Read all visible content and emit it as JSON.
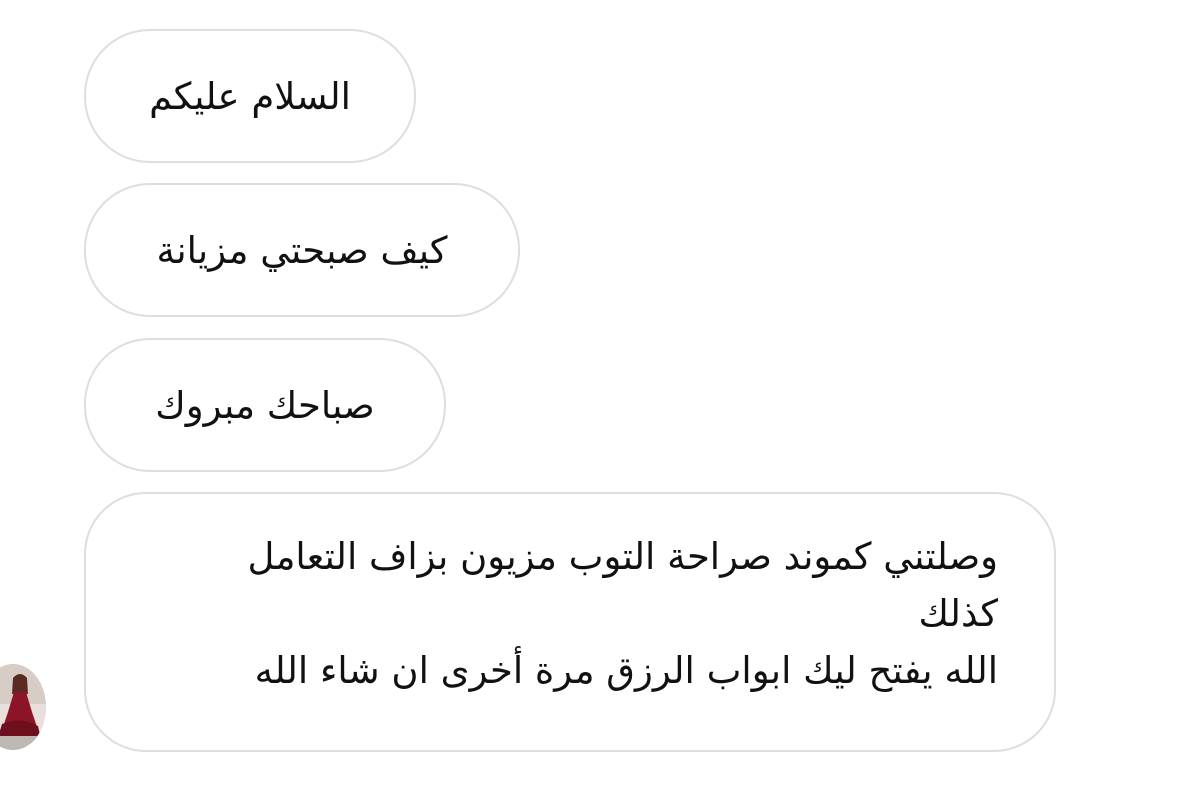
{
  "messages": [
    {
      "text": "السلام عليكم"
    },
    {
      "text": "كيف صبحتي مزيانة"
    },
    {
      "text": "صباحك مبروك"
    },
    {
      "lines": [
        "وصلتني كموند صراحة التوب مزيون بزاف التعامل",
        "كذلك",
        "الله يفتح ليك ابواب الرزق مرة أخرى ان شاء الله"
      ]
    }
  ],
  "avatar": {
    "icon": "sender-avatar-photo",
    "colors": {
      "background": "#e9dfdc",
      "dress": "#8d1326",
      "skin": "#caa48d"
    }
  },
  "colors": {
    "bubble_border": "#dedede",
    "bubble_background": "#ffffff",
    "text": "#111111"
  }
}
